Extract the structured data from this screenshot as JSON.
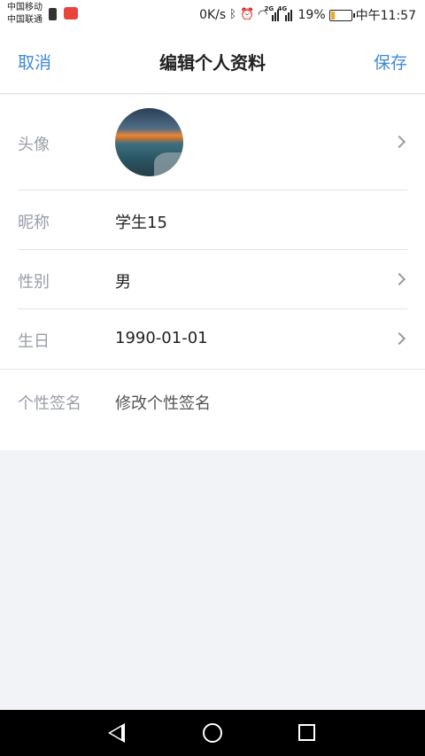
{
  "status_bar": {
    "carrier_1": "中国移动",
    "carrier_2": "中国联通",
    "net_speed": "0K/s",
    "network_1": "2G",
    "network_2": "4G",
    "battery_percent": "19%",
    "battery_level": 0.19,
    "time": "中午11:57"
  },
  "nav": {
    "cancel": "取消",
    "title": "编辑个人资料",
    "save": "保存"
  },
  "form": {
    "avatar_label": "头像",
    "nickname_label": "昵称",
    "nickname_value": "学生15",
    "gender_label": "性别",
    "gender_value": "男",
    "birthday_label": "生日",
    "birthday_value": "1990-01-01",
    "signature_label": "个性签名",
    "signature_placeholder": "修改个性签名"
  },
  "colors": {
    "accent": "#3f8ad8",
    "label": "#9a9ea8",
    "background": "#f2f3f7"
  },
  "icons": [
    "sim-icon",
    "app-notification-icon",
    "bluetooth-icon",
    "alarm-icon",
    "wifi-icon",
    "signal-icon",
    "battery-icon",
    "chevron-right-icon",
    "back-icon",
    "home-icon",
    "recent-apps-icon"
  ]
}
